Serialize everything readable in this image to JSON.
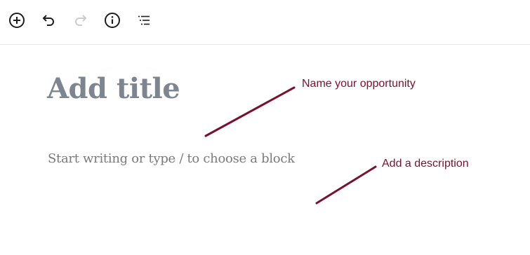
{
  "toolbar": {
    "icons": [
      {
        "name": "add-block-icon",
        "state": "enabled"
      },
      {
        "name": "undo-icon",
        "state": "enabled"
      },
      {
        "name": "redo-icon",
        "state": "disabled"
      },
      {
        "name": "info-icon",
        "state": "enabled"
      },
      {
        "name": "outline-icon",
        "state": "enabled"
      }
    ]
  },
  "editor": {
    "title_placeholder": "Add title",
    "body_placeholder": "Start writing or type / to choose a block"
  },
  "annotations": {
    "title_note": "Name your opportunity",
    "description_note": "Add a description",
    "color": "#7a1030"
  },
  "colors": {
    "icon_enabled": "#1e1e1e",
    "icon_disabled": "#cccccc",
    "title_placeholder": "#7d8591",
    "body_placeholder": "#7a7a7a",
    "divider": "#e6e6e6"
  }
}
